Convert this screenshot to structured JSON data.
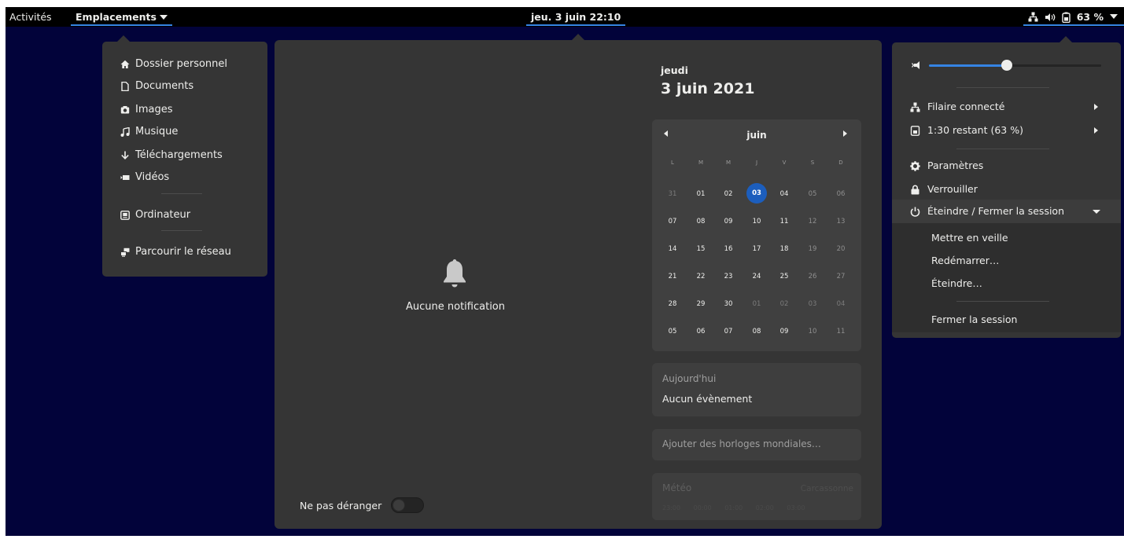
{
  "topbar": {
    "activities": "Activités",
    "places": "Emplacements",
    "clock": "jeu. 3 juin  22:10",
    "battery_percent": "63 %"
  },
  "places_menu": {
    "items": [
      {
        "label": "Dossier personnel",
        "icon": "home-icon"
      },
      {
        "label": "Documents",
        "icon": "document-icon"
      },
      {
        "label": "Images",
        "icon": "camera-icon"
      },
      {
        "label": "Musique",
        "icon": "music-icon"
      },
      {
        "label": "Téléchargements",
        "icon": "download-icon"
      },
      {
        "label": "Vidéos",
        "icon": "video-icon"
      }
    ],
    "computer": "Ordinateur",
    "network": "Parcourir le réseau"
  },
  "notifications": {
    "empty": "Aucune notification",
    "dnd_label": "Ne pas déranger",
    "dnd_on": false
  },
  "calendar": {
    "weekday": "jeudi",
    "full_date": "3 juin 2021",
    "month": "juin",
    "weekdays": [
      "L",
      "M",
      "M",
      "J",
      "V",
      "S",
      "D"
    ],
    "weeks": [
      [
        "31",
        "01",
        "02",
        "03",
        "04",
        "05",
        "06"
      ],
      [
        "07",
        "08",
        "09",
        "10",
        "11",
        "12",
        "13"
      ],
      [
        "14",
        "15",
        "16",
        "17",
        "18",
        "19",
        "20"
      ],
      [
        "21",
        "22",
        "23",
        "24",
        "25",
        "26",
        "27"
      ],
      [
        "28",
        "29",
        "30",
        "01",
        "02",
        "03",
        "04"
      ],
      [
        "05",
        "06",
        "07",
        "08",
        "09",
        "10",
        "11"
      ]
    ],
    "today": "03"
  },
  "events": {
    "title": "Aujourd'hui",
    "text": "Aucun évènement"
  },
  "world_clocks": {
    "label": "Ajouter des horloges mondiales…"
  },
  "weather": {
    "title": "Météo",
    "location": "Carcassonne",
    "times": "23:00 00:00 01:00 02:00 03:00"
  },
  "system_menu": {
    "volume": 0.45,
    "network": "Filaire connecté",
    "battery": "1:30 restant (63 %)",
    "settings": "Paramètres",
    "lock": "Verrouiller",
    "power": "Éteindre / Fermer la session",
    "suspend": "Mettre en veille",
    "restart": "Redémarrer…",
    "poweroff": "Éteindre…",
    "logout": "Fermer la session"
  },
  "colors": {
    "accent": "#3584e4",
    "desktop": "#02033a",
    "popover": "#353535"
  }
}
